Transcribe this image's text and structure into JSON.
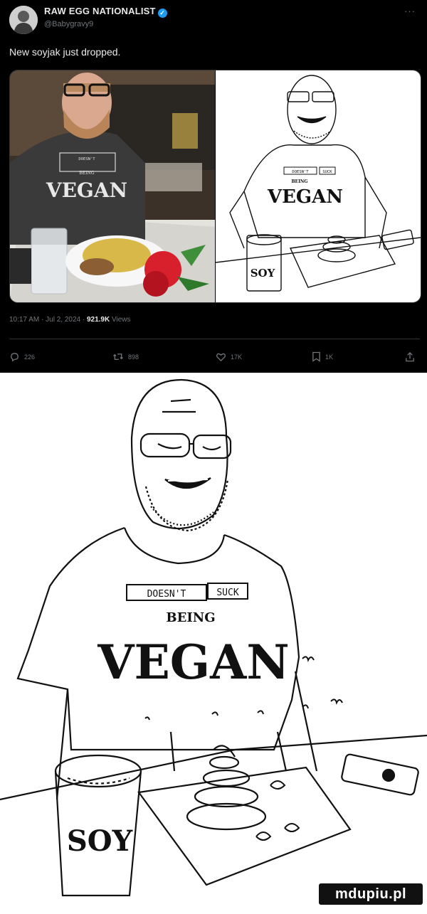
{
  "tweet": {
    "display_name": "RAW EGG NATIONALIST",
    "handle": "@Babygravy9",
    "more_label": "···",
    "text": "New soyjak just dropped.",
    "timestamp": "10:17 AM · Jul 2, 2024 · ",
    "views_count": "921.9K",
    "views_label": " Views",
    "replies": "226",
    "reposts": "898",
    "likes": "17K",
    "bookmarks": "1K"
  },
  "shirt": {
    "line1a": "DOESN'T",
    "line1b": "SUCK",
    "line2": "BEING",
    "line3": "VEGAN"
  },
  "cup_label": "SOY",
  "watermark": "mdupiu.pl",
  "icons": [
    "verified-badge-icon",
    "reply-icon",
    "repost-icon",
    "like-icon",
    "bookmark-icon",
    "share-icon"
  ],
  "colors": {
    "background": "#000000",
    "verified": "#1d9bf0",
    "text": "#e7e9ea",
    "muted": "#71767b"
  }
}
